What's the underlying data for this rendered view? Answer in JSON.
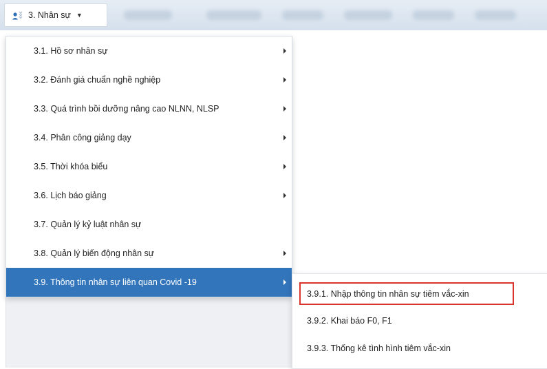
{
  "nav": {
    "menu_label": "3. Nhân sự",
    "menu_icon": "users-icon"
  },
  "menu": {
    "items": [
      {
        "label": "3.1. Hồ sơ nhân sự",
        "has_submenu": true
      },
      {
        "label": "3.2. Đánh giá chuẩn nghề nghiệp",
        "has_submenu": true
      },
      {
        "label": "3.3. Quá trình bồi dưỡng nâng cao NLNN, NLSP",
        "has_submenu": true
      },
      {
        "label": "3.4. Phân công giảng dạy",
        "has_submenu": true
      },
      {
        "label": "3.5. Thời khóa biểu",
        "has_submenu": true
      },
      {
        "label": "3.6. Lịch báo giảng",
        "has_submenu": true
      },
      {
        "label": "3.7. Quản lý kỷ luật nhân sự",
        "has_submenu": false
      },
      {
        "label": "3.8. Quản lý biến động nhân sự",
        "has_submenu": true
      },
      {
        "label": "3.9. Thông tin nhân sự liên quan Covid -19",
        "has_submenu": true,
        "active": true
      }
    ]
  },
  "submenu": {
    "items": [
      {
        "label": "3.9.1. Nhập thông tin nhân sự tiêm vắc-xin",
        "highlighted": true
      },
      {
        "label": "3.9.2. Khai báo F0, F1"
      },
      {
        "label": "3.9.3. Thống kê tình hình tiêm vắc-xin"
      }
    ]
  },
  "colors": {
    "active_bg": "#3375bb",
    "highlight_border": "#d9342b",
    "topbar": "#dfe7f0"
  }
}
